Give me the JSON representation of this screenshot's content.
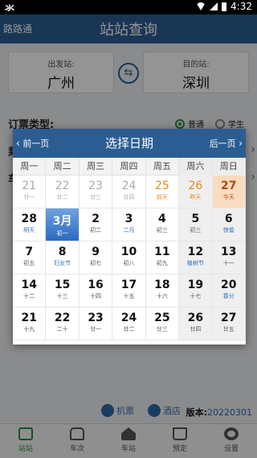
{
  "status_bar": {
    "left_text": "氺",
    "time": "4:32"
  },
  "app": {
    "brand": "路路通",
    "title": "站站查询"
  },
  "search": {
    "from_label": "出发站:",
    "from_value": "广州",
    "to_label": "目的站:",
    "to_value": "深圳",
    "ticket_type_label": "订票类型:",
    "ticket_options": [
      "普通",
      "学生"
    ],
    "ticket_selected": "普通",
    "row2_label": "乘",
    "row3_label": "车"
  },
  "footer": {
    "plane": "机票",
    "hotel": "酒店",
    "version_label": "版本:",
    "version_value": "20220301"
  },
  "bottom_nav": [
    {
      "label": "站站",
      "icon": "station-icon",
      "active": true
    },
    {
      "label": "车次",
      "icon": "bus-icon",
      "active": false
    },
    {
      "label": "车站",
      "icon": "home-icon",
      "active": false
    },
    {
      "label": "预定",
      "icon": "cart-icon",
      "active": false
    },
    {
      "label": "设置",
      "icon": "gear-icon",
      "active": false
    }
  ],
  "date_picker": {
    "title": "选择日期",
    "prev_label": "前一页",
    "next_label": "后一页",
    "weekdays": [
      "周一",
      "周二",
      "周三",
      "周四",
      "周五",
      "周六",
      "周日"
    ],
    "weeks": [
      [
        {
          "d": "21",
          "s": "廿一",
          "state": "past"
        },
        {
          "d": "22",
          "s": "廿二",
          "state": "past"
        },
        {
          "d": "23",
          "s": "廿三",
          "state": "past"
        },
        {
          "d": "24",
          "s": "廿四",
          "state": "past"
        },
        {
          "d": "25",
          "s": "前天",
          "state": "orange"
        },
        {
          "d": "26",
          "s": "昨天",
          "state": "orange"
        },
        {
          "d": "27",
          "s": "今天",
          "state": "today"
        }
      ],
      [
        {
          "d": "28",
          "s": "明天",
          "state": "normal",
          "sub": "blue"
        },
        {
          "d": "3月",
          "s": "初一",
          "state": "selected"
        },
        {
          "d": "2",
          "s": "初二",
          "state": "normal"
        },
        {
          "d": "3",
          "s": "二月",
          "state": "normal",
          "sub": "blue"
        },
        {
          "d": "4",
          "s": "初三",
          "state": "normal"
        },
        {
          "d": "5",
          "s": "初三",
          "state": "normal"
        },
        {
          "d": "6",
          "s": "惊蛰",
          "state": "normal",
          "sub": "blue"
        }
      ],
      [
        {
          "d": "7",
          "s": "初五",
          "state": "normal"
        },
        {
          "d": "8",
          "s": "妇女节",
          "state": "normal",
          "sub": "blue"
        },
        {
          "d": "9",
          "s": "初七",
          "state": "normal"
        },
        {
          "d": "10",
          "s": "初八",
          "state": "normal"
        },
        {
          "d": "11",
          "s": "初九",
          "state": "normal"
        },
        {
          "d": "12",
          "s": "植树节",
          "state": "normal",
          "sub": "blue"
        },
        {
          "d": "13",
          "s": "十一",
          "state": "normal"
        }
      ],
      [
        {
          "d": "14",
          "s": "十二",
          "state": "normal"
        },
        {
          "d": "15",
          "s": "十三",
          "state": "normal"
        },
        {
          "d": "16",
          "s": "十四",
          "state": "normal"
        },
        {
          "d": "17",
          "s": "十五",
          "state": "normal"
        },
        {
          "d": "18",
          "s": "十六",
          "state": "normal"
        },
        {
          "d": "19",
          "s": "十七",
          "state": "normal"
        },
        {
          "d": "20",
          "s": "春分",
          "state": "normal",
          "sub": "blue"
        }
      ],
      [
        {
          "d": "21",
          "s": "十九",
          "state": "normal"
        },
        {
          "d": "22",
          "s": "二十",
          "state": "normal"
        },
        {
          "d": "23",
          "s": "廿一",
          "state": "normal"
        },
        {
          "d": "24",
          "s": "廿二",
          "state": "normal"
        },
        {
          "d": "25",
          "s": "廿三",
          "state": "normal"
        },
        {
          "d": "26",
          "s": "廿四",
          "state": "normal"
        },
        {
          "d": "27",
          "s": "廿五",
          "state": "normal"
        }
      ]
    ]
  }
}
